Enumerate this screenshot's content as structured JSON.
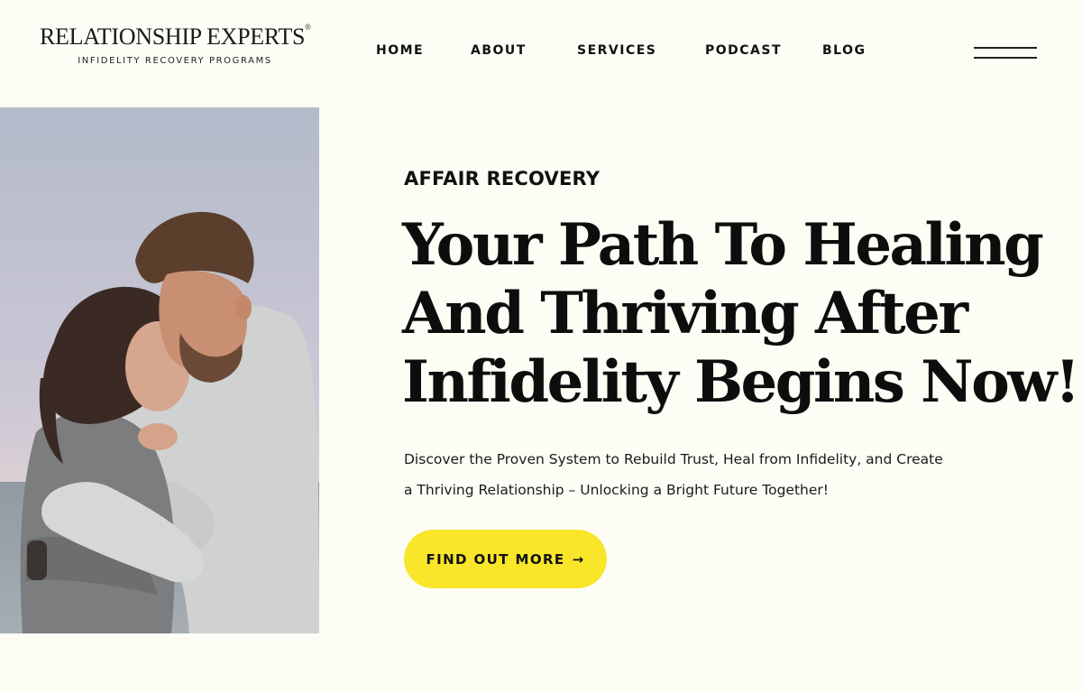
{
  "brand": {
    "name": "RELATIONSHIP EXPERTS",
    "registered_mark": "®",
    "tagline": "INFIDELITY RECOVERY PROGRAMS"
  },
  "nav": {
    "items": [
      "HOME",
      "ABOUT",
      "SERVICES",
      "PODCAST",
      "BLOG"
    ],
    "menu_icon": "hamburger-menu-icon"
  },
  "hero": {
    "eyebrow": "AFFAIR RECOVERY",
    "headline_lines": [
      "Your Path To Healing",
      "And Thriving After",
      "Infidelity Begins Now!"
    ],
    "description_lines": [
      "Discover the Proven System to Rebuild Trust, Heal from Infidelity, and Create",
      "a Thriving Relationship – Unlocking a Bright Future Together!"
    ],
    "cta_label": "FIND OUT MORE",
    "cta_arrow": "→"
  },
  "colors": {
    "background": "#fdfdf5",
    "cta": "#f9e529",
    "text": "#111111"
  }
}
